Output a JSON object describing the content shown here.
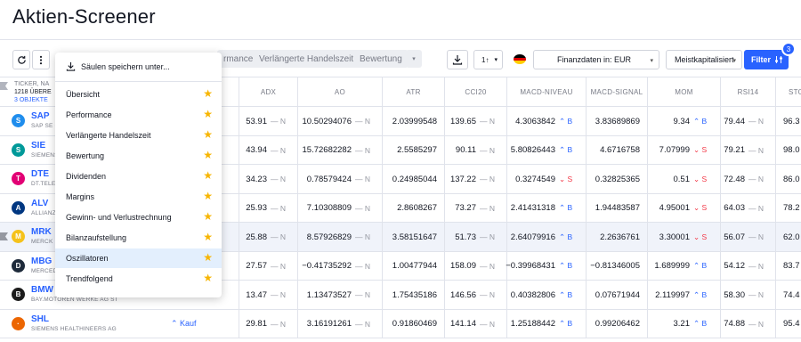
{
  "page_title": "Aktien-Screener",
  "toolbar": {
    "refresh_icon": "refresh-icon",
    "more_icon": "more-vertical-icon",
    "chip_performance": "rmance",
    "chip_extended_hours": "Verlängerte Handelszeit",
    "chip_valuation": "Bewertung",
    "sort_label": "1↑",
    "currency_label": "Finanzdaten in: EUR",
    "sort_select": "Meistkapitalisiert",
    "filter_label": "Filter",
    "filter_count": "3"
  },
  "dropdown": {
    "save_label": "Säulen speichern unter...",
    "items": [
      {
        "label": "Übersicht"
      },
      {
        "label": "Performance"
      },
      {
        "label": "Verlängerte Handelszeit"
      },
      {
        "label": "Bewertung"
      },
      {
        "label": "Dividenden"
      },
      {
        "label": "Margins"
      },
      {
        "label": "Gewinn- und Verlustrechnung"
      },
      {
        "label": "Bilanzaufstellung"
      },
      {
        "label": "Oszillatoren"
      },
      {
        "label": "Trendfolgend"
      }
    ],
    "active_index": 8
  },
  "table": {
    "ticker_header": "TICKER, NA",
    "count_header": "1218 ÜBERE",
    "selected_header": "3 OBJEKTE",
    "columns": [
      "ADX",
      "AO",
      "ATR",
      "CCI20",
      "MACD-NIVEAU",
      "MACD-SIGNAL",
      "MOM",
      "RSI14",
      "STO"
    ],
    "rows": [
      {
        "ticker": "SAP",
        "name": "SAP SE O",
        "logo_color": "#1f8ded",
        "logo_text": "S",
        "rating": "",
        "adx": "53.91",
        "adx_s": "— N",
        "ao": "10.50294076",
        "ao_s": "— N",
        "atr": "2.03999548",
        "cci": "139.65",
        "cci_s": "— N",
        "macd": "4.3063842",
        "macd_s": "⌃ B",
        "sig": "3.83689869",
        "mom": "9.34",
        "mom_s": "⌃ B",
        "rsi": "79.44",
        "rsi_s": "— N",
        "sto": "96.3"
      },
      {
        "ticker": "SIE",
        "name": "SIEMENS",
        "logo_color": "#009999",
        "logo_text": "S",
        "rating": "",
        "adx": "43.94",
        "adx_s": "— N",
        "ao": "15.72682282",
        "ao_s": "— N",
        "atr": "2.5585297",
        "cci": "90.11",
        "cci_s": "— N",
        "macd": "5.80826443",
        "macd_s": "⌃ B",
        "sig": "4.6716758",
        "mom": "7.07999",
        "mom_s": "⌄ S",
        "rsi": "79.21",
        "rsi_s": "— N",
        "sto": "98.0"
      },
      {
        "ticker": "DTE",
        "name": "DT.TELE",
        "logo_color": "#e20074",
        "logo_text": "T",
        "rating": "",
        "adx": "34.23",
        "adx_s": "— N",
        "ao": "0.78579424",
        "ao_s": "— N",
        "atr": "0.24985044",
        "cci": "137.22",
        "cci_s": "— N",
        "macd": "0.3274549",
        "macd_s": "⌄ S",
        "sig": "0.32825365",
        "mom": "0.51",
        "mom_s": "⌄ S",
        "rsi": "72.48",
        "rsi_s": "— N",
        "sto": "86.0"
      },
      {
        "ticker": "ALV",
        "name": "ALLIANZ",
        "logo_color": "#003781",
        "logo_text": "A",
        "rating": "",
        "adx": "25.93",
        "adx_s": "— N",
        "ao": "7.10308809",
        "ao_s": "— N",
        "atr": "2.8608267",
        "cci": "73.27",
        "cci_s": "— N",
        "macd": "2.41431318",
        "macd_s": "⌃ B",
        "sig": "1.94483587",
        "mom": "4.95001",
        "mom_s": "⌄ S",
        "rsi": "64.03",
        "rsi_s": "— N",
        "sto": "78.2"
      },
      {
        "ticker": "MRK",
        "name": "MERCK K",
        "logo_color": "#f5c21b",
        "logo_text": "M",
        "rating": "",
        "adx": "25.88",
        "adx_s": "— N",
        "ao": "8.57926829",
        "ao_s": "— N",
        "atr": "3.58151647",
        "cci": "51.73",
        "cci_s": "— N",
        "macd": "2.64079916",
        "macd_s": "⌃ B",
        "sig": "2.2636761",
        "mom": "3.30001",
        "mom_s": "⌄ S",
        "rsi": "56.07",
        "rsi_s": "— N",
        "sto": "62.0"
      },
      {
        "ticker": "MBG",
        "name": "MERCED",
        "logo_color": "#1e2a3a",
        "logo_text": "D",
        "rating": "",
        "adx": "27.57",
        "adx_s": "— N",
        "ao": "−0.41735292",
        "ao_s": "— N",
        "atr": "1.00477944",
        "cci": "158.09",
        "cci_s": "— N",
        "macd": "−0.39968431",
        "macd_s": "⌃ B",
        "sig": "−0.81346005",
        "mom": "1.689999",
        "mom_s": "⌃ B",
        "rsi": "54.12",
        "rsi_s": "— N",
        "sto": "83.7"
      },
      {
        "ticker": "BMW",
        "name": "BAY.MOTOREN WERKE AG ST",
        "logo_color": "#1c1c1c",
        "logo_text": "B",
        "rating": "",
        "adx": "13.47",
        "adx_s": "— N",
        "ao": "1.13473527",
        "ao_s": "— N",
        "atr": "1.75435186",
        "cci": "146.56",
        "cci_s": "— N",
        "macd": "0.40382806",
        "macd_s": "⌃ B",
        "sig": "0.07671944",
        "mom": "2.119997",
        "mom_s": "⌃ B",
        "rsi": "58.30",
        "rsi_s": "— N",
        "sto": "74.4"
      },
      {
        "ticker": "SHL",
        "name": "SIEMENS HEALTHINEERS AG",
        "logo_color": "#ec6602",
        "logo_text": "·",
        "rating": "⌃ Kauf",
        "adx": "29.81",
        "adx_s": "— N",
        "ao": "3.16191261",
        "ao_s": "— N",
        "atr": "0.91860469",
        "cci": "141.14",
        "cci_s": "— N",
        "macd": "1.25188442",
        "macd_s": "⌃ B",
        "sig": "0.99206462",
        "mom": "3.21",
        "mom_s": "⌃ B",
        "rsi": "74.88",
        "rsi_s": "— N",
        "sto": "95.4"
      }
    ]
  }
}
